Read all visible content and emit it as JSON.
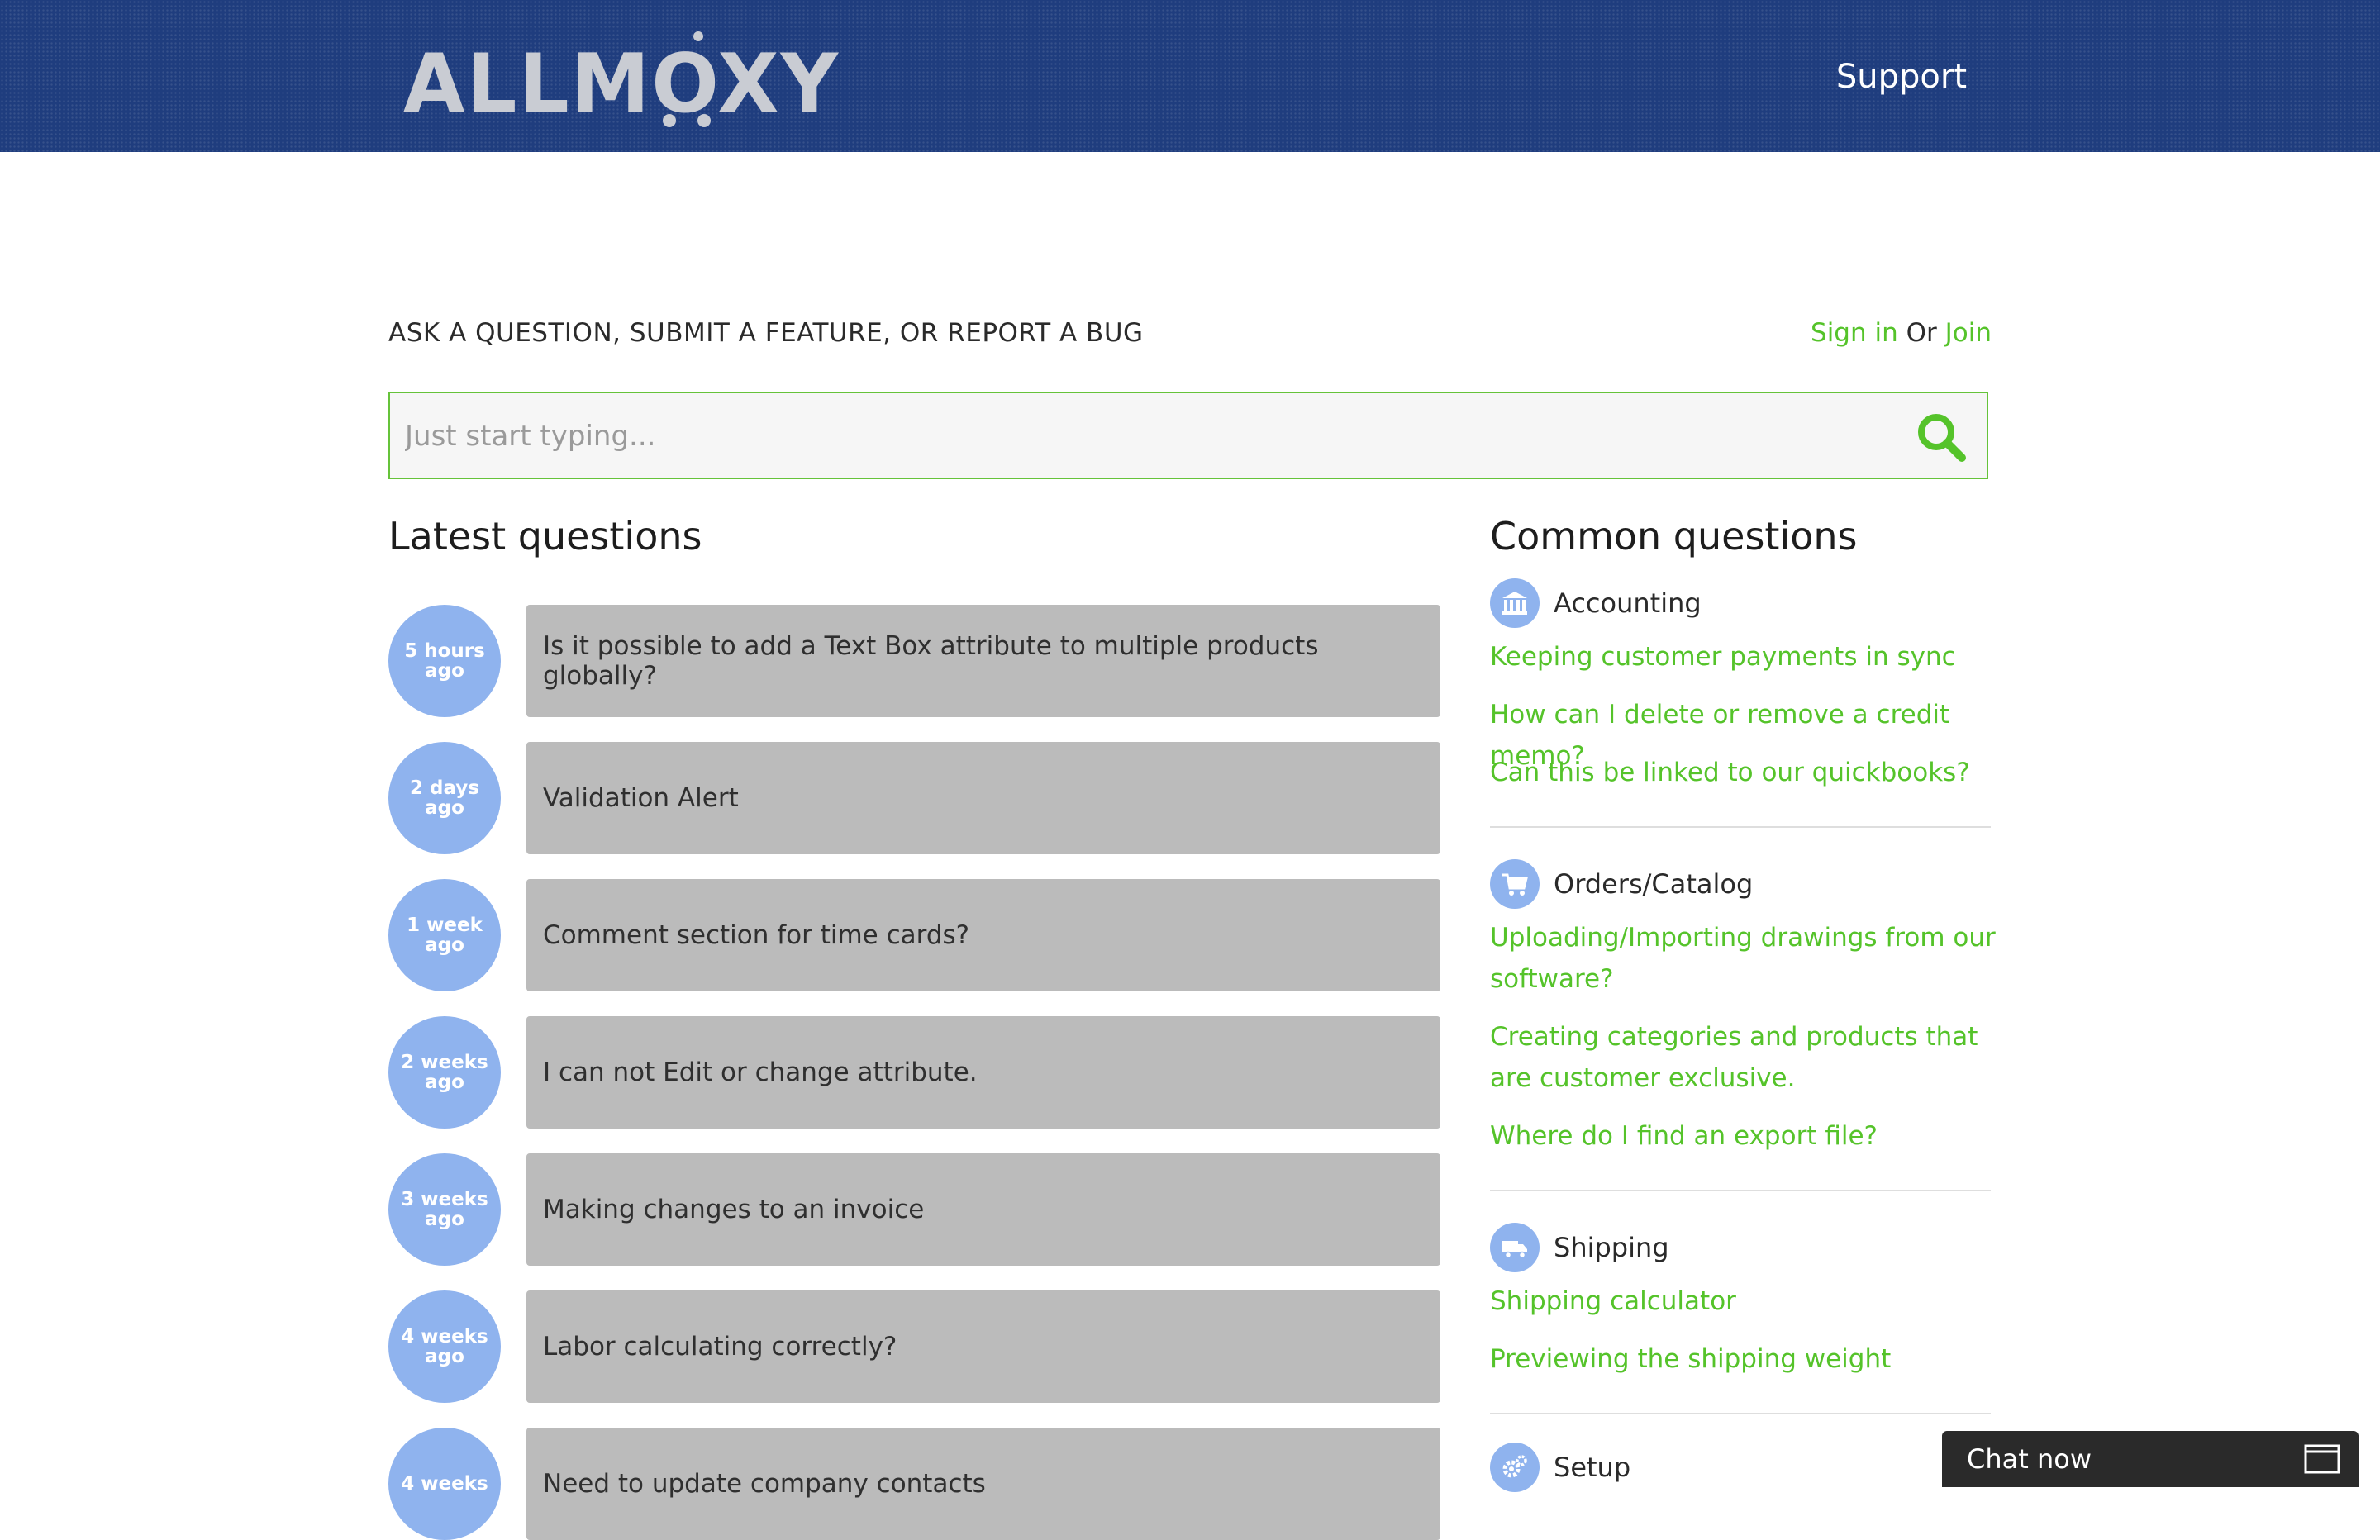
{
  "header": {
    "logo_text": "ALLMOXY",
    "nav_support": "Support"
  },
  "intro": {
    "heading": "ASK A QUESTION, SUBMIT A FEATURE, OR REPORT A BUG",
    "sign_in": "Sign in",
    "or": "Or",
    "join": "Join"
  },
  "search": {
    "placeholder": "Just start typing...",
    "icon": "search-icon"
  },
  "latest": {
    "title": "Latest questions",
    "items": [
      {
        "time": "5 hours ago",
        "question": "Is it possible to add a Text Box attribute to multiple products globally?"
      },
      {
        "time": "2 days ago",
        "question": "Validation Alert"
      },
      {
        "time": "1 week ago",
        "question": "Comment section for time cards?"
      },
      {
        "time": "2 weeks ago",
        "question": "I can not Edit or change attribute."
      },
      {
        "time": "3 weeks ago",
        "question": "Making changes to an invoice"
      },
      {
        "time": "4 weeks ago",
        "question": "Labor calculating correctly?"
      },
      {
        "time": "4 weeks",
        "question": "Need to update company contacts"
      }
    ]
  },
  "common": {
    "title": "Common questions",
    "categories": [
      {
        "label": "Accounting",
        "icon": "bank-icon",
        "links": [
          "Keeping customer payments in sync",
          "How can I delete or remove a credit memo?",
          "Can this be linked to our quickbooks?"
        ]
      },
      {
        "label": "Orders/Catalog",
        "icon": "cart-icon",
        "links": [
          "Uploading/Importing drawings from our software?",
          "Creating categories and products that are customer exclusive.",
          "Where do I find an export file?"
        ]
      },
      {
        "label": "Shipping",
        "icon": "truck-icon",
        "links": [
          "Shipping calculator",
          "Previewing the shipping weight"
        ]
      },
      {
        "label": "Setup",
        "icon": "gears-icon",
        "links": []
      }
    ]
  },
  "chat": {
    "label": "Chat now",
    "icon": "window-icon"
  },
  "colors": {
    "header_bg": "#1f3d7e",
    "accent_green": "#55c32a",
    "bubble_blue": "#8fb3ee",
    "question_box": "#bbbbbb",
    "chat_bg": "#2a2a2a"
  }
}
